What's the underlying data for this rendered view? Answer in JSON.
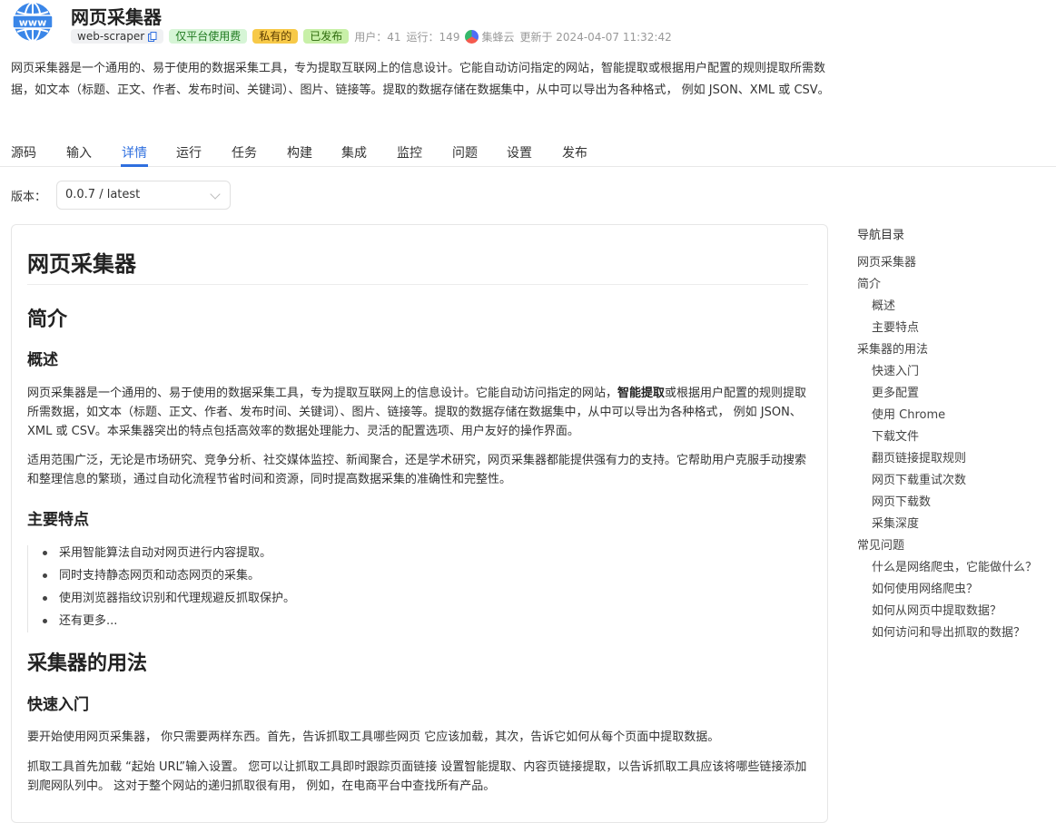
{
  "app": {
    "title": "网页采集器",
    "id_tag": "web-scraper",
    "tags": [
      "仅平台使用费",
      "私有的",
      "已发布"
    ],
    "users": "用户：41",
    "runs": "运行：149",
    "provider": "集蜂云",
    "updated": "更新于 2024-04-07 11:32:42",
    "description": "网页采集器是一个通用的、易于使用的数据采集工具，专为提取互联网上的信息设计。它能自动访问指定的网站，智能提取或根据用户配置的规则提取所需数据，如文本（标题、正文、作者、发布时间、关键词）、图片、链接等。提取的数据存储在数据集中，从中可以导出为各种格式， 例如 JSON、XML 或 CSV。"
  },
  "tabs": [
    "源码",
    "输入",
    "详情",
    "运行",
    "任务",
    "构建",
    "集成",
    "监控",
    "问题",
    "设置",
    "发布"
  ],
  "active_tab": "详情",
  "version": {
    "label": "版本：",
    "value": "0.0.7 / latest"
  },
  "doc": {
    "h1": "网页采集器",
    "intro_h2": "简介",
    "overview_h3": "概述",
    "overview_p1_a": "网页采集器是一个通用的、易于使用的数据采集工具，专为提取互联网上的信息设计。它能自动访问指定的网站，",
    "overview_p1_bold": "智能提取",
    "overview_p1_b": "或根据用户配置的规则提取所需数据，如文本（标题、正文、作者、发布时间、关键词）、图片、链接等。提取的数据存储在数据集中，从中可以导出为各种格式， 例如 JSON、XML 或 CSV。本采集器突出的特点包括高效率的数据处理能力、灵活的配置选项、用户友好的操作界面。",
    "overview_p2": "适用范围广泛，无论是市场研究、竞争分析、社交媒体监控、新闻聚合，还是学术研究，网页采集器都能提供强有力的支持。它帮助用户克服手动搜索和整理信息的繁琐，通过自动化流程节省时间和资源，同时提高数据采集的准确性和完整性。",
    "features_h3": "主要特点",
    "features": [
      "采用智能算法自动对网页进行内容提取。",
      "同时支持静态网页和动态网页的采集。",
      "使用浏览器指纹识别和代理规避反抓取保护。",
      "还有更多..."
    ],
    "usage_h2": "采集器的用法",
    "quickstart_h3": "快速入门",
    "quickstart_p1": "要开始使用网页采集器， 你只需要两样东西。首先，告诉抓取工具哪些网页 它应该加载，其次，告诉它如何从每个页面中提取数据。",
    "quickstart_p2": "抓取工具首先加载 “起始 URL”输入设置。 您可以让抓取工具即时跟踪页面链接 设置智能提取、内容页链接提取，以告诉抓取工具应该将哪些链接添加到爬网队列中。 这对于整个网站的递归抓取很有用， 例如，在电商平台中查找所有产品。"
  },
  "toc": {
    "title": "导航目录",
    "items": [
      {
        "label": "网页采集器",
        "level": 1
      },
      {
        "label": "简介",
        "level": 1
      },
      {
        "label": "概述",
        "level": 2
      },
      {
        "label": "主要特点",
        "level": 2
      },
      {
        "label": "采集器的用法",
        "level": 1
      },
      {
        "label": "快速入门",
        "level": 2
      },
      {
        "label": "更多配置",
        "level": 2
      },
      {
        "label": "使用 Chrome",
        "level": 2
      },
      {
        "label": "下载文件",
        "level": 2
      },
      {
        "label": "翻页链接提取规则",
        "level": 2
      },
      {
        "label": "网页下载重试次数",
        "level": 2
      },
      {
        "label": "网页下载数",
        "level": 2
      },
      {
        "label": "采集深度",
        "level": 2
      },
      {
        "label": "常见问题",
        "level": 1
      },
      {
        "label": "什么是网络爬虫，它能做什么？",
        "level": 2
      },
      {
        "label": "如何使用网络爬虫？",
        "level": 2
      },
      {
        "label": "如何从网页中提取数据？",
        "level": 2
      },
      {
        "label": "如何访问和导出抓取的数据？",
        "level": 2
      }
    ]
  },
  "colors": {
    "accent": "#2f6fdf",
    "tag_green_bg": "#d6f5d6",
    "tag_yellow_bg": "#f7c948",
    "tag_lime_bg": "#c8f0a8"
  },
  "icons": [
    "globe-icon",
    "copy-icon",
    "provider-logo-icon",
    "chevron-down-icon"
  ]
}
